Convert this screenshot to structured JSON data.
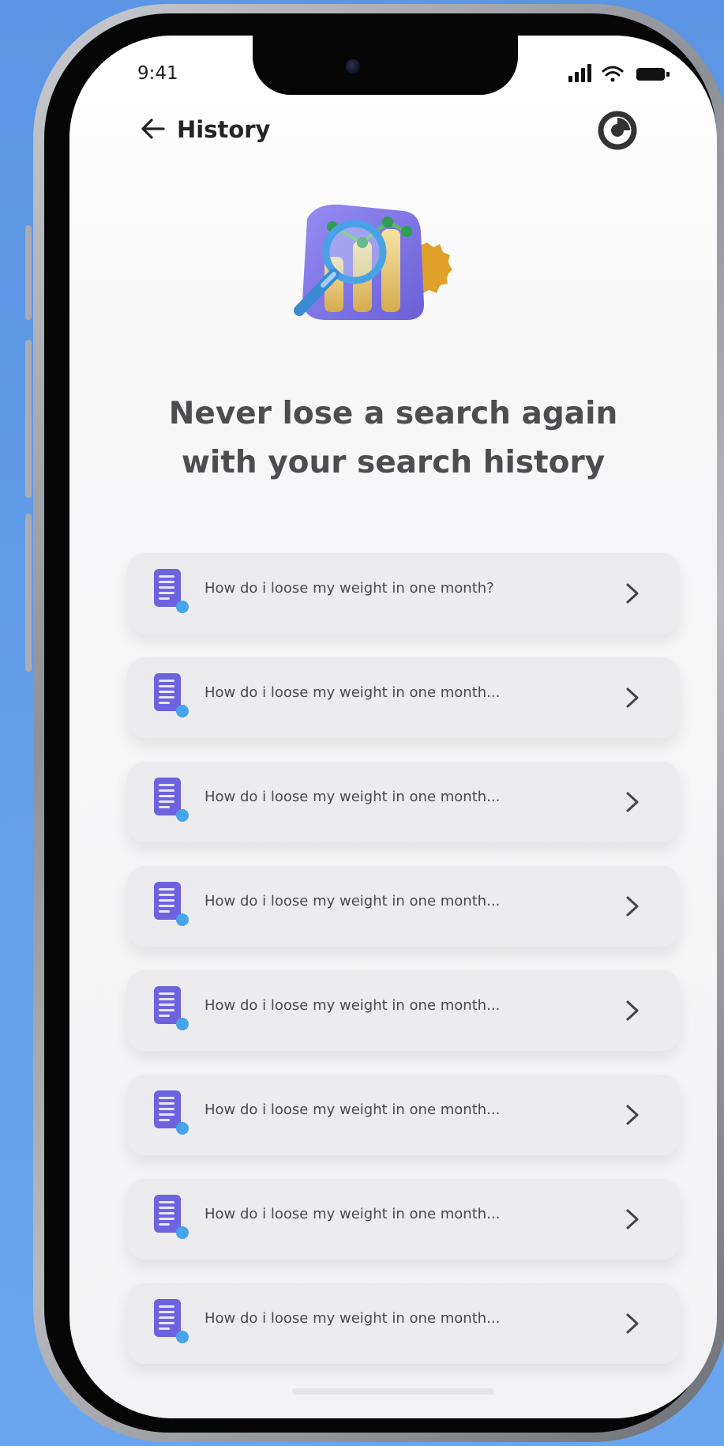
{
  "status_bar": {
    "time": "9:41"
  },
  "header": {
    "title": "History",
    "back_icon": "arrow-left-icon",
    "theme_icon": "contrast-toggle-icon"
  },
  "hero": {
    "illustration": "search-analytics-illustration"
  },
  "headline": {
    "line1": "Never lose a search again",
    "line2": "with your search history"
  },
  "history": {
    "items": [
      {
        "text": "How do i loose my weight in one month?",
        "icon": "document-search-icon"
      },
      {
        "text": "How do i loose my weight in one month...",
        "icon": "document-search-icon"
      },
      {
        "text": "How do i loose my weight in one month...",
        "icon": "document-search-icon"
      },
      {
        "text": "How do i loose my weight in one month...",
        "icon": "document-search-icon"
      },
      {
        "text": "How do i loose my weight in one month...",
        "icon": "document-search-icon"
      },
      {
        "text": "How do i loose my weight in one month...",
        "icon": "document-search-icon"
      },
      {
        "text": "How do i loose my weight in one month...",
        "icon": "document-search-icon"
      },
      {
        "text": "How do i loose my weight in one month...",
        "icon": "document-search-icon"
      }
    ]
  },
  "colors": {
    "background": "#5b95e3",
    "card": "#ececee",
    "accent_purple": "#6d63df",
    "accent_blue": "#47a3ea",
    "headline": "#4d4d4f"
  }
}
